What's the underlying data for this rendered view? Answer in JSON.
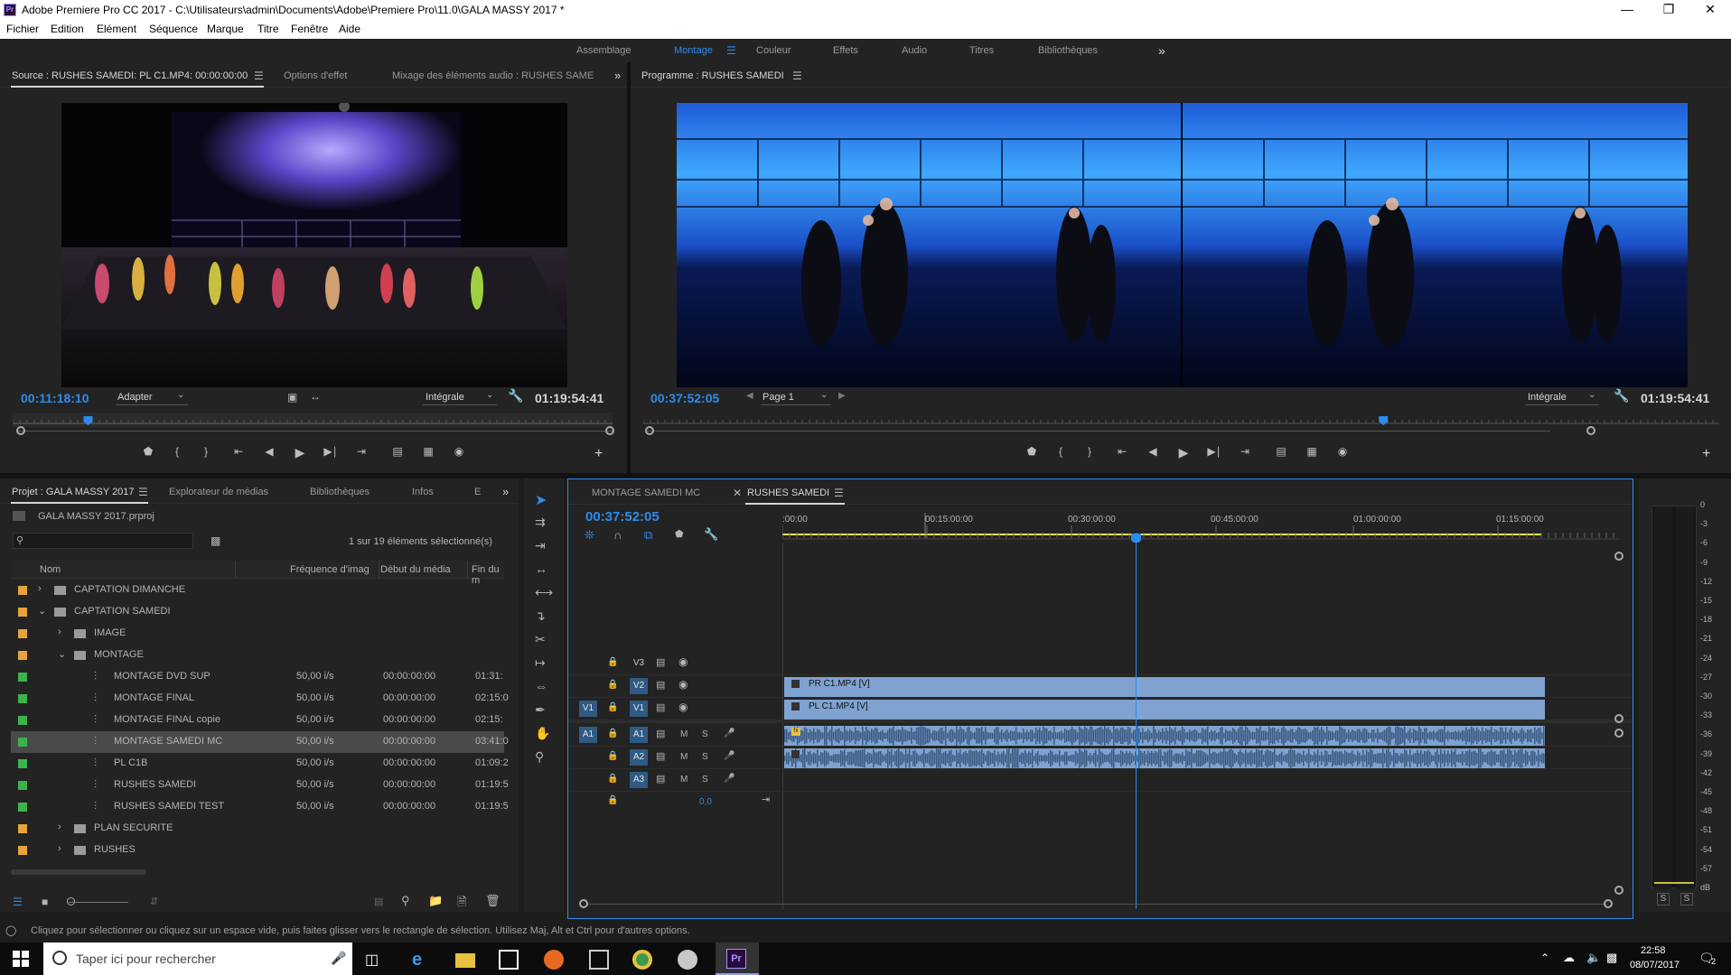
{
  "window": {
    "title": "Adobe Premiere Pro CC 2017 - C:\\Utilisateurs\\admin\\Documents\\Adobe\\Premiere Pro\\11.0\\GALA MASSY 2017 *",
    "app_icon": "Pr"
  },
  "menu": [
    "Fichier",
    "Edition",
    "Elément",
    "Séquence",
    "Marque",
    "Titre",
    "Fenêtre",
    "Aide"
  ],
  "workspaces": {
    "tabs": [
      "Assemblage",
      "Montage",
      "Couleur",
      "Effets",
      "Audio",
      "Titres",
      "Bibliothèques"
    ],
    "active": "Montage",
    "overflow": "»"
  },
  "source_monitor": {
    "tabs": [
      "Source : RUSHES SAMEDI: PL C1.MP4: 00:00:00:00",
      "Options d'effet",
      "Mixage des éléments audio : RUSHES SAME"
    ],
    "timecode_current": "00:11:18:10",
    "zoom": "Adapter",
    "quality": "Intégrale",
    "timecode_duration": "01:19:54:41",
    "playhead_fraction": 0.12
  },
  "program_monitor": {
    "title": "Programme : RUSHES SAMEDI",
    "timecode_current": "00:37:52:05",
    "page": "Page 1",
    "quality": "Intégrale",
    "timecode_duration": "01:19:54:41",
    "playhead_fraction": 0.69
  },
  "project": {
    "tabs": [
      "Projet : GALA MASSY 2017",
      "Explorateur de médias",
      "Bibliothèques",
      "Infos",
      "E"
    ],
    "file": "GALA MASSY 2017.prproj",
    "selection_status": "1 sur 19 éléments sélectionné(s)",
    "columns": [
      "Nom",
      "Fréquence d'imag",
      "Début du média",
      "Fin du m"
    ],
    "rows": [
      {
        "name": "CAPTATION DIMANCHE",
        "type": "bin",
        "indent": 0,
        "expanded": false,
        "color": "#e8a33d",
        "fps": "",
        "start": "",
        "end": ""
      },
      {
        "name": "CAPTATION SAMEDI",
        "type": "bin",
        "indent": 0,
        "expanded": true,
        "color": "#e8a33d",
        "fps": "",
        "start": "",
        "end": ""
      },
      {
        "name": "IMAGE",
        "type": "bin",
        "indent": 1,
        "expanded": false,
        "color": "#e8a33d",
        "fps": "",
        "start": "",
        "end": ""
      },
      {
        "name": "MONTAGE",
        "type": "bin",
        "indent": 1,
        "expanded": true,
        "color": "#e8a33d",
        "fps": "",
        "start": "",
        "end": ""
      },
      {
        "name": "MONTAGE DVD SUP",
        "type": "seq",
        "indent": 2,
        "color": "#3cb44b",
        "fps": "50,00 i/s",
        "start": "00:00:00:00",
        "end": "01:31:"
      },
      {
        "name": "MONTAGE FINAL",
        "type": "seq",
        "indent": 2,
        "color": "#3cb44b",
        "fps": "50,00 i/s",
        "start": "00:00:00:00",
        "end": "02:15:0"
      },
      {
        "name": "MONTAGE FINAL copie",
        "type": "seq",
        "indent": 2,
        "color": "#3cb44b",
        "fps": "50,00 i/s",
        "start": "00:00:00:00",
        "end": "02:15:"
      },
      {
        "name": "MONTAGE SAMEDI MC",
        "type": "seq",
        "indent": 2,
        "color": "#3cb44b",
        "fps": "50,00 i/s",
        "start": "00:00:00:00",
        "end": "03:41:0",
        "selected": true
      },
      {
        "name": "PL C1B",
        "type": "seq",
        "indent": 2,
        "color": "#3cb44b",
        "fps": "50,00 i/s",
        "start": "00:00:00:00",
        "end": "01:09:2"
      },
      {
        "name": "RUSHES SAMEDI",
        "type": "seq",
        "indent": 2,
        "color": "#3cb44b",
        "fps": "50,00 i/s",
        "start": "00:00:00:00",
        "end": "01:19:5"
      },
      {
        "name": "RUSHES SAMEDI TEST",
        "type": "seq",
        "indent": 2,
        "color": "#3cb44b",
        "fps": "50,00 i/s",
        "start": "00:00:00:00",
        "end": "01:19:5"
      },
      {
        "name": "PLAN SECURITE",
        "type": "bin",
        "indent": 1,
        "expanded": false,
        "color": "#e8a33d",
        "fps": "",
        "start": "",
        "end": ""
      },
      {
        "name": "RUSHES",
        "type": "bin",
        "indent": 1,
        "expanded": false,
        "color": "#e8a33d",
        "fps": "",
        "start": "",
        "end": ""
      }
    ]
  },
  "timeline": {
    "tabs": [
      "MONTAGE SAMEDI MC",
      "RUSHES SAMEDI"
    ],
    "active": "RUSHES SAMEDI",
    "timecode": "00:37:52:05",
    "ruler_labels": [
      ":00:00",
      "00:15:00:00",
      "00:30:00:00",
      "00:45:00:00",
      "01:00:00:00",
      "01:15:00:00"
    ],
    "playhead_fraction": 0.4205,
    "video_tracks": [
      "V3",
      "V2",
      "V1"
    ],
    "audio_tracks": [
      "A1",
      "A2",
      "A3"
    ],
    "source_patch_video": "V1",
    "source_patch_audio": "A1",
    "master_value": "0,0",
    "clips": {
      "v2": "PR C1.MP4 [V]",
      "v1": "PL C1.MP4 [V]"
    },
    "mute_label": "M",
    "solo_label": "S"
  },
  "audio_meter": {
    "scale": [
      "0",
      "-3",
      "-6",
      "-9",
      "-12",
      "-15",
      "-18",
      "-21",
      "-24",
      "-27",
      "-30",
      "-33",
      "-36",
      "-39",
      "-42",
      "-45",
      "-48",
      "-51",
      "-54",
      "-57",
      "dB"
    ],
    "solo_buttons": [
      "S",
      "S"
    ]
  },
  "status_bar": "Cliquez pour sélectionner ou cliquez sur un espace vide, puis faites glisser vers le rectangle de sélection. Utilisez Maj, Alt et Ctrl pour d'autres options.",
  "taskbar": {
    "search_placeholder": "Taper ici pour rechercher",
    "time": "22:58",
    "date": "08/07/2017",
    "notification_count": "2"
  }
}
